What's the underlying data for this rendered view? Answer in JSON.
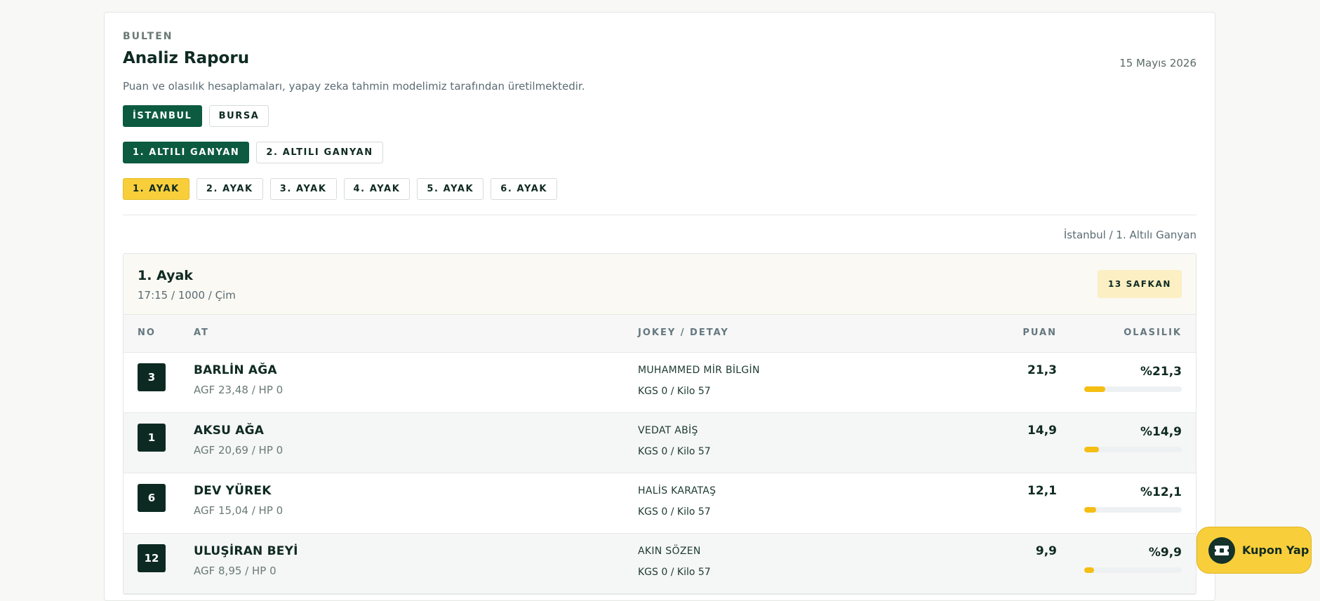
{
  "header": {
    "eyebrow": "BULTEN",
    "title": "Analiz Raporu",
    "date": "15 Mayıs 2026",
    "description": "Puan ve olasılık hesaplamaları, yapay zeka tahmin modelimiz tarafından üretilmektedir."
  },
  "cities": [
    "İSTANBUL",
    "BURSA"
  ],
  "ganyans": [
    "1. ALTILI GANYAN",
    "2. ALTILI GANYAN"
  ],
  "ayaks": [
    "1. AYAK",
    "2. AYAK",
    "3. AYAK",
    "4. AYAK",
    "5. AYAK",
    "6. AYAK"
  ],
  "breadcrumb": "İstanbul / 1. Altılı Ganyan",
  "race": {
    "title": "1. Ayak",
    "subtitle": "17:15 / 1000 / Çim",
    "badge": "13 SAFKAN"
  },
  "table": {
    "headers": {
      "no": "NO",
      "at": "AT",
      "jokey": "JOKEY / DETAY",
      "puan": "PUAN",
      "olasilik": "OLASILIK"
    },
    "rows": [
      {
        "no": "3",
        "name": "BARLİN AĞA",
        "sub": "AGF 23,48 / HP 0",
        "jockey": "MUHAMMED MİR BİLGİN",
        "detail": "KGS 0 / Kilo 57",
        "puan": "21,3",
        "olasilik": "%21,3",
        "fill": 21.3
      },
      {
        "no": "1",
        "name": "AKSU AĞA",
        "sub": "AGF 20,69 / HP 0",
        "jockey": "VEDAT ABİŞ",
        "detail": "KGS 0 / Kilo 57",
        "puan": "14,9",
        "olasilik": "%14,9",
        "fill": 14.9
      },
      {
        "no": "6",
        "name": "DEV YÜREK",
        "sub": "AGF 15,04 / HP 0",
        "jockey": "HALİS KARATAŞ",
        "detail": "KGS 0 / Kilo 57",
        "puan": "12,1",
        "olasilik": "%12,1",
        "fill": 12.1
      },
      {
        "no": "12",
        "name": "ULUŞİRAN BEYİ",
        "sub": "AGF 8,95 / HP 0",
        "jockey": "AKIN SÖZEN",
        "detail": "KGS 0 / Kilo 57",
        "puan": "9,9",
        "olasilik": "%9,9",
        "fill": 9.9
      }
    ]
  },
  "kupon_label": "Kupon Yap",
  "colors": {
    "primary": "#0c5a3f",
    "accent": "#f8cf3a",
    "bar": "#f4be13"
  }
}
